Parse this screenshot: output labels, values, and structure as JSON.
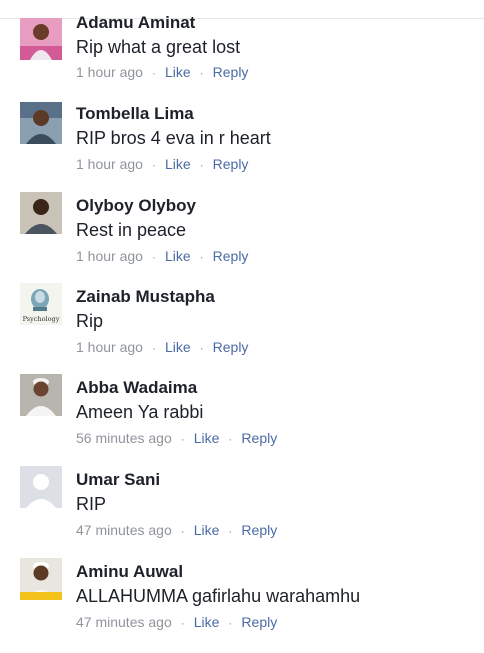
{
  "comments": [
    {
      "name": "Adamu Aminat",
      "text": "Rip what a great lost",
      "time": "1 hour ago",
      "like": "Like",
      "reply": "Reply",
      "avatar": "woman-photo"
    },
    {
      "name": "Tombella Lima",
      "text": "RIP bros 4 eva in r heart",
      "time": "1 hour ago",
      "like": "Like",
      "reply": "Reply",
      "avatar": "man-photo"
    },
    {
      "name": "Olyboy Olyboy",
      "text": "Rest in peace",
      "time": "1 hour ago",
      "like": "Like",
      "reply": "Reply",
      "avatar": "man-portrait"
    },
    {
      "name": "Zainab Mustapha",
      "text": "Rip",
      "time": "1 hour ago",
      "like": "Like",
      "reply": "Reply",
      "avatar": "psychology-logo",
      "avatar_caption": "Psychology"
    },
    {
      "name": "Abba Wadaima",
      "text": "Ameen Ya rabbi",
      "time": "56 minutes ago",
      "like": "Like",
      "reply": "Reply",
      "avatar": "man-white-cap"
    },
    {
      "name": "Umar Sani",
      "text": "RIP",
      "time": "47 minutes ago",
      "like": "Like",
      "reply": "Reply",
      "avatar": "default-silhouette"
    },
    {
      "name": "Aminu Auwal",
      "text": "ALLAHUMMA gafirlahu warahamhu",
      "time": "47 minutes ago",
      "like": "Like",
      "reply": "Reply",
      "avatar": "man-white-cap-yellow"
    }
  ],
  "separator": "·",
  "colors": {
    "name": "#1d2129",
    "meta": "#90949c",
    "link": "#4b6aa5"
  }
}
